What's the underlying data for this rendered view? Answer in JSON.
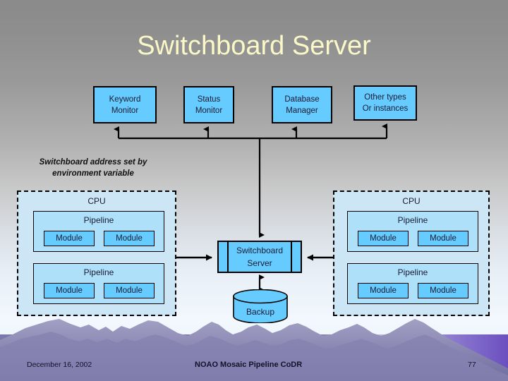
{
  "slide": {
    "title": "Switchboard Server",
    "title_color": "#fbf8c8",
    "background_top_color": "#8a8a8a",
    "background_bottom_color": "#eaf4fb"
  },
  "note": {
    "line1": "Switchboard address set by",
    "line2": "environment variable"
  },
  "top_boxes": [
    {
      "line1": "Keyword",
      "line2": "Monitor"
    },
    {
      "line1": "Status",
      "line2": "Monitor"
    },
    {
      "line1": "Database",
      "line2": "Manager"
    },
    {
      "line1": "Other types",
      "line2": "Or instances"
    }
  ],
  "cpus": [
    {
      "label": "CPU",
      "pipelines": [
        {
          "label": "Pipeline",
          "modules": [
            "Module",
            "Module"
          ]
        },
        {
          "label": "Pipeline",
          "modules": [
            "Module",
            "Module"
          ]
        }
      ]
    },
    {
      "label": "CPU",
      "pipelines": [
        {
          "label": "Pipeline",
          "modules": [
            "Module",
            "Module"
          ]
        },
        {
          "label": "Pipeline",
          "modules": [
            "Module",
            "Module"
          ]
        }
      ]
    }
  ],
  "server": {
    "line1": "Switchboard",
    "line2": "Server",
    "fill_color": "#66ccff"
  },
  "backup": {
    "label": "Backup",
    "fill_color": "#66ccff"
  },
  "footer": {
    "date": "December 16, 2002",
    "center": "NOAO Mosaic Pipeline CoDR",
    "page": "77"
  },
  "colors": {
    "box_fill": "#66ccff",
    "cpu_fill": "#cde6f5",
    "pipeline_fill": "#aee0fa",
    "outline": "#000000",
    "mountain_dark": "#6d6a9c",
    "mountain_light": "#9a97bd",
    "footer_band": "#7b78ab"
  }
}
